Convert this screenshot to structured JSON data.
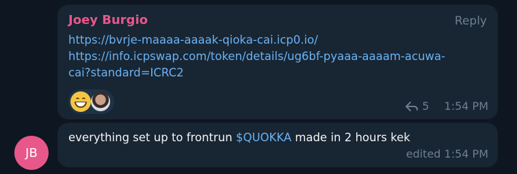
{
  "message1": {
    "sender": "Joey Burgio",
    "reply_label": "Reply",
    "link1": "https://bvrje-maaaa-aaaak-qioka-cai.icp0.io/",
    "link2_line1": "https://info.icpswap.com/token/details/ug6bf-pyaaa-aaaam-acuwa-",
    "link2_line2": "cai?standard=ICRC2",
    "forwards_count": "5",
    "time": "1:54 PM",
    "reactions": [
      "grinning-face-emoji",
      "user-avatar-reaction"
    ]
  },
  "message2": {
    "text_before": "everything set up to frontrun ",
    "cashtag": "$QUOKKA",
    "text_after": " made in 2 hours kek",
    "meta": "edited 1:54 PM"
  },
  "avatar": {
    "initials": "JB",
    "color": "#e8578a"
  },
  "colors": {
    "background": "#0e1621",
    "bubble": "#182533",
    "link": "#6ab3f3",
    "sender": "#e8578a",
    "meta": "#6d7f8f"
  }
}
